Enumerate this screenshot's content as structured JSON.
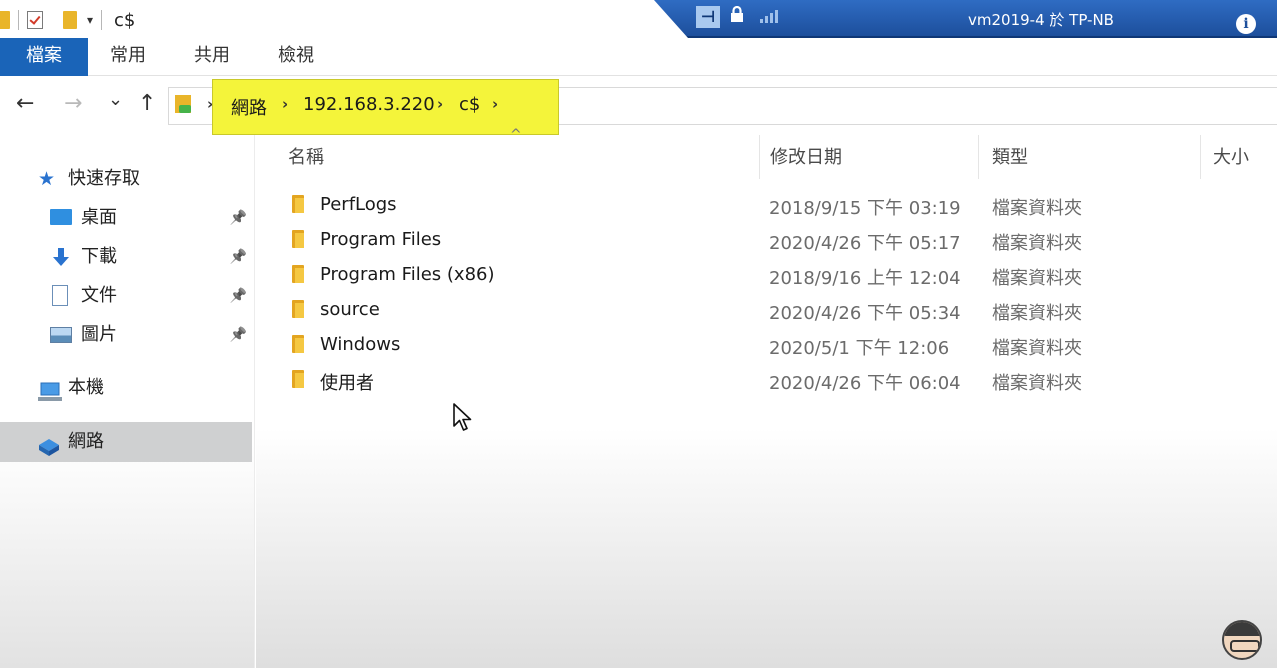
{
  "titlebar": {
    "window_title": "c$",
    "dropdown_glyph": "▾"
  },
  "remote": {
    "title": "vm2019-4 於 TP-NB",
    "info_glyph": "i",
    "pin_glyph": "⊣",
    "lock_glyph": "🔒"
  },
  "ribbon": {
    "tabs": [
      "檔案",
      "常用",
      "共用",
      "檢視"
    ]
  },
  "nav": {
    "back_glyph": "←",
    "forward_glyph": "→",
    "recent_glyph": "⌄",
    "up_glyph": "↑"
  },
  "address": {
    "lead_sep": "›",
    "crumbs": [
      "網路",
      "192.168.3.220",
      "c$"
    ],
    "sep": "›"
  },
  "sidebar": {
    "quick_access": "快速存取",
    "items": [
      {
        "label": "桌面",
        "icon": "desktop-icon"
      },
      {
        "label": "下載",
        "icon": "download-icon"
      },
      {
        "label": "文件",
        "icon": "document-icon"
      },
      {
        "label": "圖片",
        "icon": "picture-icon"
      }
    ],
    "pin_glyph": "📌",
    "this_pc": "本機",
    "network": "網路"
  },
  "columns": {
    "name": "名稱",
    "date": "修改日期",
    "type": "類型",
    "size": "大小",
    "sort_caret": "^"
  },
  "files": [
    {
      "name": "PerfLogs",
      "date": "2018/9/15 下午 03:19",
      "type": "檔案資料夾"
    },
    {
      "name": "Program Files",
      "date": "2020/4/26 下午 05:17",
      "type": "檔案資料夾"
    },
    {
      "name": "Program Files (x86)",
      "date": "2018/9/16 上午 12:04",
      "type": "檔案資料夾"
    },
    {
      "name": "source",
      "date": "2020/4/26 下午 05:34",
      "type": "檔案資料夾"
    },
    {
      "name": "Windows",
      "date": "2020/5/1 下午 12:06",
      "type": "檔案資料夾"
    },
    {
      "name": "使用者",
      "date": "2020/4/26 下午 06:04",
      "type": "檔案資料夾"
    }
  ],
  "colors": {
    "accent": "#1a64b8",
    "highlight": "#f4f43a",
    "folder": "#e3a521",
    "remote_bar": "#2f6cc3"
  }
}
